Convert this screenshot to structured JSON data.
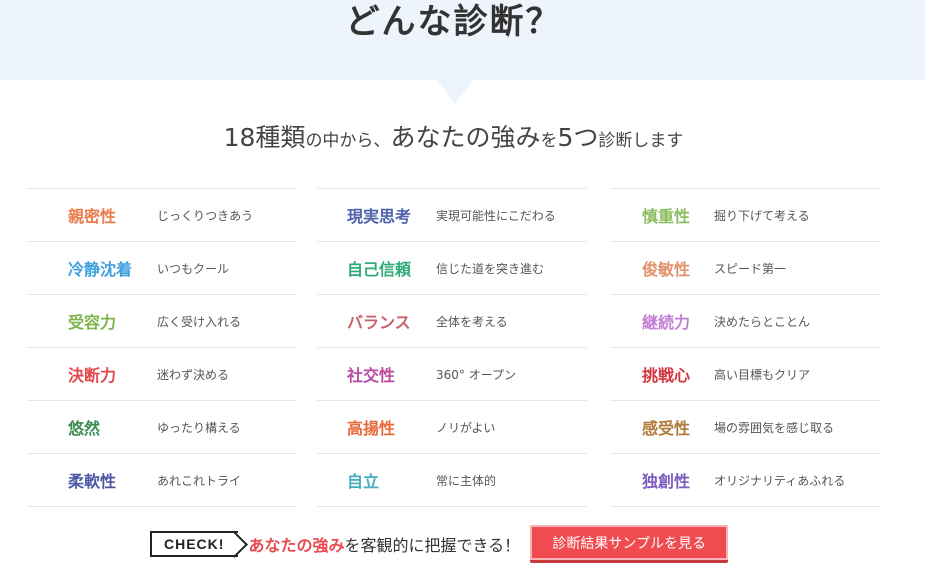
{
  "hero": {
    "title": "どんな診断？"
  },
  "subtitle": {
    "p1": "18種類",
    "p2": "の中から、",
    "p3": "あなたの強み",
    "p4": "を",
    "p5": "5つ",
    "p6": "診断します"
  },
  "columns": [
    [
      {
        "name": "親密性",
        "desc": "じっくりつきあう",
        "color": "#ea7b4b"
      },
      {
        "name": "冷静沈着",
        "desc": "いつもクール",
        "color": "#3ea0dd"
      },
      {
        "name": "受容力",
        "desc": "広く受け入れる",
        "color": "#7fb44b"
      },
      {
        "name": "決断力",
        "desc": "迷わず決める",
        "color": "#e4474d"
      },
      {
        "name": "悠然",
        "desc": "ゆったり構える",
        "color": "#3b8c4f"
      },
      {
        "name": "柔軟性",
        "desc": "あれこれトライ",
        "color": "#4a58a6"
      }
    ],
    [
      {
        "name": "現実思考",
        "desc": "実現可能性にこだわる",
        "color": "#4f62ad"
      },
      {
        "name": "自己信頼",
        "desc": "信じた道を突き進む",
        "color": "#2faa78"
      },
      {
        "name": "バランス",
        "desc": "全体を考える",
        "color": "#c6616c"
      },
      {
        "name": "社交性",
        "desc": "360° オープン",
        "color": "#b94a9f"
      },
      {
        "name": "高揚性",
        "desc": "ノリがよい",
        "color": "#e86a3b"
      },
      {
        "name": "自立",
        "desc": "常に主体的",
        "color": "#45aec0"
      }
    ],
    [
      {
        "name": "慎重性",
        "desc": "掘り下げて考える",
        "color": "#8bbc5f"
      },
      {
        "name": "俊敏性",
        "desc": "スピード第一",
        "color": "#e1926b"
      },
      {
        "name": "継続力",
        "desc": "決めたらとことん",
        "color": "#c47ed4"
      },
      {
        "name": "挑戦心",
        "desc": "高い目標もクリア",
        "color": "#d3363d"
      },
      {
        "name": "感受性",
        "desc": "場の雰囲気を感じ取る",
        "color": "#b07a3a"
      },
      {
        "name": "独創性",
        "desc": "オリジナリティあふれる",
        "color": "#7b5bbf"
      }
    ]
  ],
  "check": {
    "badge": "CHECK!",
    "accent": "あなたの強み",
    "rest": "を客観的に把握できる！",
    "button": "診断結果サンプルを見る"
  }
}
